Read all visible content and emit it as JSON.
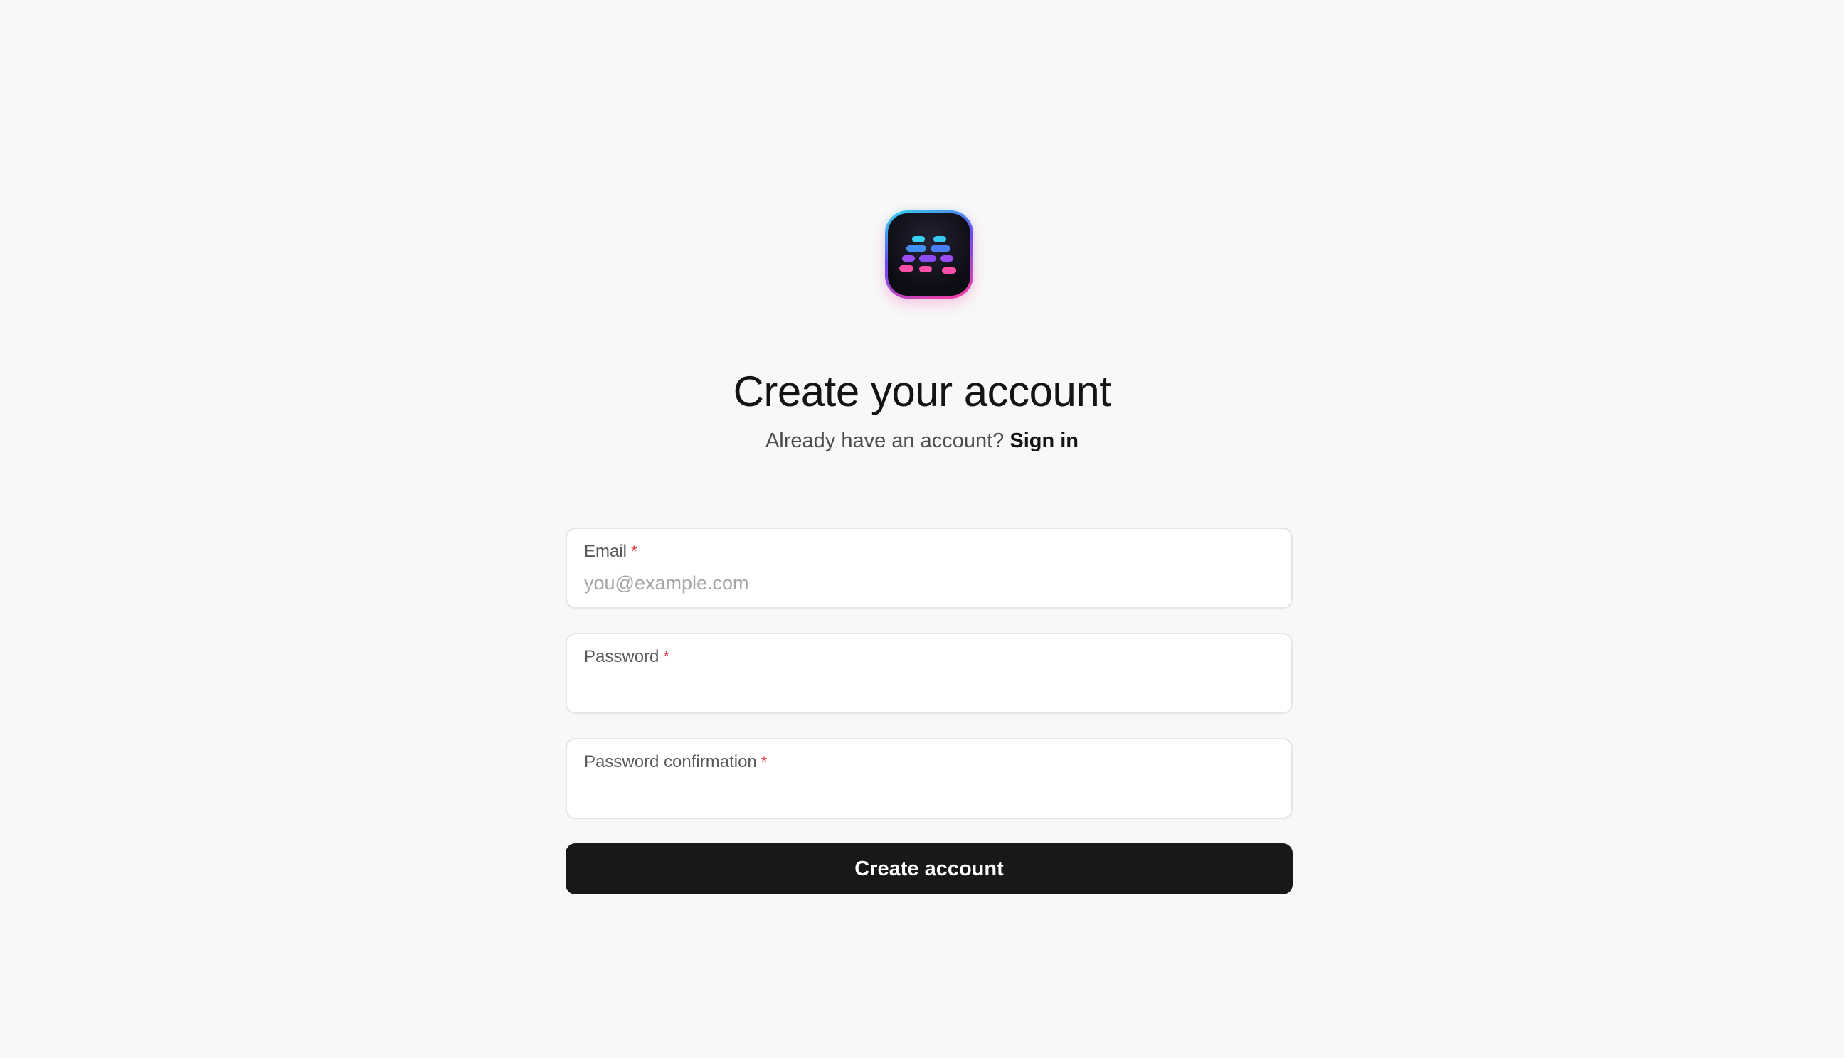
{
  "logo": {
    "icon": "app-logo-icon",
    "colors": {
      "top": "#2fd6ec",
      "middle": "#6b4cf0",
      "bottom": "#ff3f9e"
    }
  },
  "header": {
    "title": "Create your account",
    "subtitle_prefix": "Already have an account?",
    "sign_in_link": "Sign in"
  },
  "form": {
    "email": {
      "label": "Email",
      "required_mark": "*",
      "value": "",
      "placeholder": "you@example.com"
    },
    "password": {
      "label": "Password",
      "required_mark": "*",
      "value": "",
      "placeholder": ""
    },
    "password_confirmation": {
      "label": "Password confirmation",
      "required_mark": "*",
      "value": "",
      "placeholder": ""
    },
    "submit_label": "Create account"
  },
  "colors": {
    "background": "#f8f8f8",
    "button": "#181818",
    "required": "#e0383e"
  }
}
